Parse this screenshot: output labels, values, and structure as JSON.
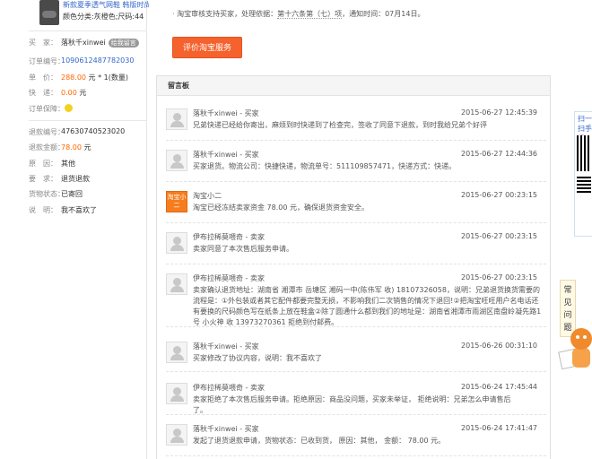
{
  "product": {
    "name": "新款夏季透气网鞋 韩版时尚…",
    "color": "颜色分类:灰橙色;尺码:44"
  },
  "order_info": {
    "buyer_label": "买　家：",
    "buyer_value": "落秋千xinwei",
    "buyer_tag": "给我留言",
    "order_no_label": "订单编号：",
    "order_no_value": "1090612487782030",
    "price_label": "单　价：",
    "price_value": "288.00",
    "price_unit": "元",
    "price_qty": "* 1(数量)",
    "shipping_label": "快　递：",
    "shipping_value": "0.00",
    "shipping_unit": "元",
    "guarantee_label": "订单保障："
  },
  "refund_info": {
    "refund_no_label": "退款编号：",
    "refund_no_value": "47630740523020",
    "amount_label": "退款金额：",
    "amount_value": "78.00",
    "amount_unit": "元",
    "reason_label": "原　因：",
    "reason_value": "其他",
    "request_label": "要　求：",
    "request_value": "退货退款",
    "goods_status_label": "货物状态：",
    "goods_status_value": "已寄回",
    "note_label": "说　明：",
    "note_value": "我不喜欢了"
  },
  "notice": {
    "prefix": "· 淘宝审核支持买家，处理依据：",
    "rule": "第十六条第（七）项",
    "suffix": "，通知时间：07月14日。"
  },
  "evaluate_button": "评价淘宝服务",
  "board_title": "留言板",
  "messages": [
    {
      "who": "落秋千xinwei - 买家",
      "time": "2015-06-27 12:45:39",
      "text": "兄弟快递已经给你寄出，麻烦到时快递到了检查完，签收了同意下退款，到时我给兄弟个好评"
    },
    {
      "who": "落秋千xinwei - 买家",
      "time": "2015-06-27 12:44:36",
      "text": "买家退货。物流公司：快捷快递，物流单号：511109857471，快递方式：快递。"
    },
    {
      "who": "淘宝小二",
      "time": "2015-06-27 00:23:15",
      "text": "淘宝已经冻结卖家资金 78.00 元，确保退货资金安全。",
      "avatar": "淘宝小二"
    },
    {
      "who": "伊布拉稀莫喂奇 - 卖家",
      "time": "2015-06-27 00:23:15",
      "text": "卖家同意了本次售后服务申请。"
    },
    {
      "who": "伊布拉稀莫喂奇 - 卖家",
      "time": "2015-06-27 00:23:15",
      "text": "卖家确认退货地址：湖南省 湘潭市 岳塘区 湘码一中(陈伟军 收) 18107326058，说明：兄弟退货换货需要的流程是：①外包装或者其它配件都要完整无损，不影响我们二次销售的情况下退回!②把淘宝旺旺用户名电话还有要换的尺码颜色写在纸条上放在鞋盒②除了圆通什么都到我们的地址是：湖南省湘潭市雨湖区南盘岭凝先路1号 小火神 收 13973270361 拒绝到付邮费。"
    },
    {
      "who": "落秋千xinwei - 买家",
      "time": "2015-06-26 00:31:10",
      "text": "买家修改了协议内容，说明：我不喜欢了"
    },
    {
      "who": "伊布拉稀莫喂奇 - 卖家",
      "time": "2015-06-24 17:45:44",
      "text": "卖家拒绝了本次售后服务申请。拒绝原因：商品没问题，买家未举证， 拒绝说明：兄弟怎么申请售后了。"
    },
    {
      "who": "落秋千xinwei - 买家",
      "time": "2015-06-24 17:41:47",
      "text": "发起了退货退款申请，货物状态：已收到货， 原因：其他， 金额： 78.00 元。"
    }
  ],
  "side": {
    "scan_text": "扫一扫手机",
    "faq_text": "常见问题"
  }
}
